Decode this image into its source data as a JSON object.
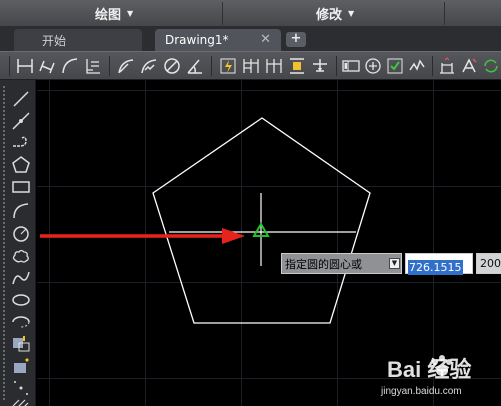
{
  "menubar": {
    "draw_label": "绘图",
    "modify_label": "修改"
  },
  "tabs": {
    "start_label": "开始",
    "drawing_label": "Drawing1*",
    "close_symbol": "✕",
    "new_tab_symbol": "+"
  },
  "ribbon_icons": [
    "linear-dimension-icon",
    "aligned-dimension-icon",
    "arc-length-icon",
    "ordinate-dimension-icon",
    "radius-dimension-icon",
    "jogged-dimension-icon",
    "diameter-dimension-icon",
    "angular-dimension-icon",
    "quick-dimension-icon",
    "baseline-dimension-icon",
    "continue-dimension-icon",
    "dimension-space-icon",
    "dimension-break-icon",
    "tolerance-icon",
    "center-mark-icon",
    "inspection-icon",
    "jogged-linear-icon",
    "dimension-edit-icon",
    "dimension-text-edit-icon",
    "dimension-update-icon"
  ],
  "left_tools": [
    "line-icon",
    "construction-line-icon",
    "polyline-icon",
    "polygon-icon",
    "rectangle-icon",
    "arc-icon",
    "circle-icon",
    "revision-cloud-icon",
    "spline-icon",
    "ellipse-icon",
    "ellipse-arc-icon",
    "insert-block-icon",
    "make-block-icon",
    "point-icon",
    "hatch-icon"
  ],
  "command_prompt": {
    "text": "指定圆的圆心或",
    "arrow_symbol": "▼",
    "x_value": "726.1515",
    "y_value_partial": "200"
  },
  "watermark": {
    "brand": "Bai 经验",
    "url": "jingyan.baidu.com"
  },
  "colors": {
    "canvas_bg": "#000000",
    "geometry": "#ffffff",
    "crosshair": "#ffffff",
    "snap_marker": "#22c02a",
    "annotation_arrow": "#e8231b",
    "selection": "#3170c8"
  }
}
